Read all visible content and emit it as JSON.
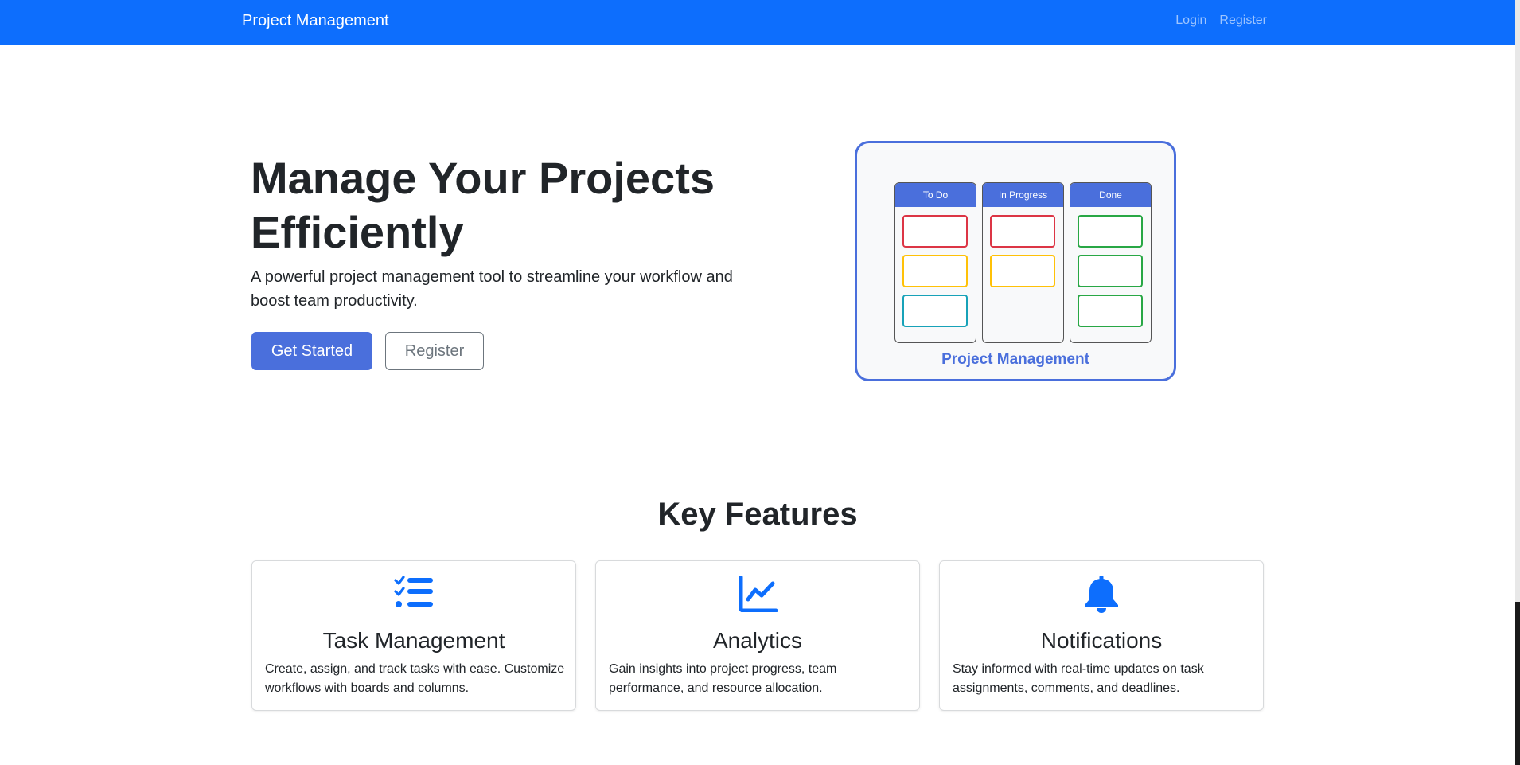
{
  "navbar": {
    "brand": "Project Management",
    "links": [
      "Login",
      "Register"
    ]
  },
  "hero": {
    "title": "Manage Your Projects Efficiently",
    "lead": "A powerful project management tool to streamline your workflow and boost team productivity.",
    "primary_button": "Get Started",
    "secondary_button": "Register"
  },
  "illustration": {
    "columns": [
      {
        "title": "To Do",
        "card_colors": [
          "#dc3545",
          "#ffc107",
          "#17a2b8"
        ]
      },
      {
        "title": "In Progress",
        "card_colors": [
          "#dc3545",
          "#ffc107"
        ]
      },
      {
        "title": "Done",
        "card_colors": [
          "#28a745",
          "#28a745",
          "#28a745"
        ]
      }
    ],
    "caption": "Project Management"
  },
  "features": {
    "title": "Key Features",
    "cards": [
      {
        "icon": "task-list-icon",
        "title": "Task Management",
        "text": "Create, assign, and track tasks with ease. Customize workflows with boards and columns."
      },
      {
        "icon": "line-chart-icon",
        "title": "Analytics",
        "text": "Gain insights into project progress, team performance, and resource allocation."
      },
      {
        "icon": "bell-icon",
        "title": "Notifications",
        "text": "Stay informed with real-time updates on task assignments, comments, and deadlines."
      }
    ]
  },
  "colors": {
    "navbar": "#0d6efd",
    "accent": "#4a6fdc",
    "icon": "#0d6efd"
  }
}
